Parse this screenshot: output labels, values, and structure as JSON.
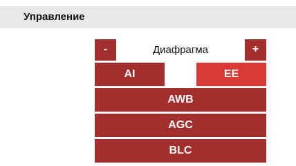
{
  "header": {
    "title": "Управление"
  },
  "controls": {
    "iris": {
      "minus_label": "-",
      "label": "Диафрагма",
      "plus_label": "+"
    },
    "mode_buttons": {
      "ai_label": "AI",
      "ee_label": "EE",
      "active": "EE"
    },
    "awb_label": "AWB",
    "agc_label": "AGC",
    "blc_label": "BLC"
  },
  "colors": {
    "button": "#a22e2e",
    "button_active": "#d93a38",
    "header_bg": "#e9e9e9"
  }
}
